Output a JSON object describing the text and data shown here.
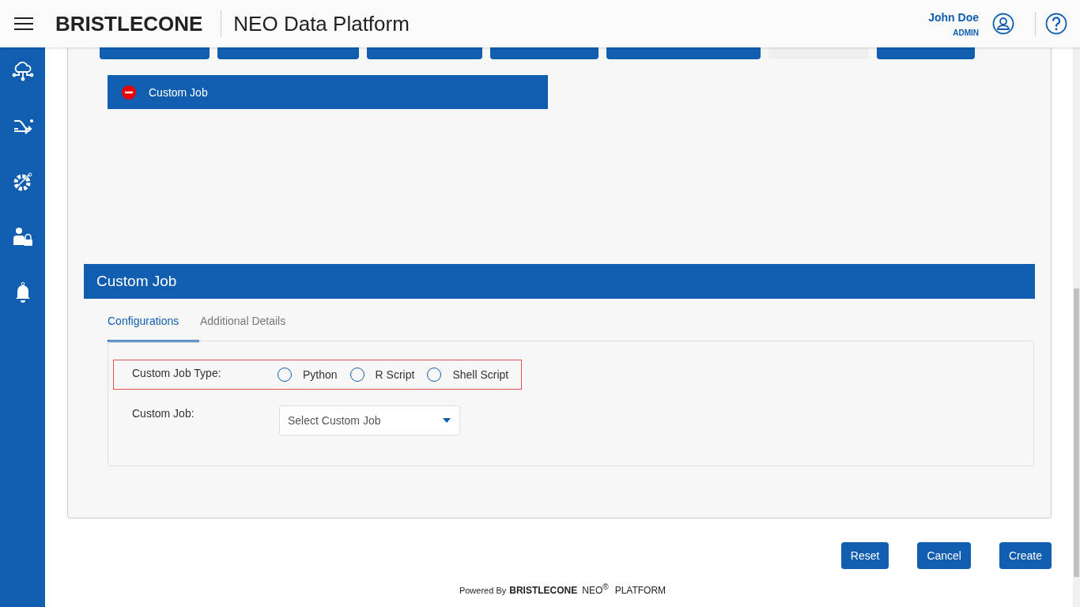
{
  "header": {
    "logo": "BRISTLECONE",
    "title": "NEO Data Platform",
    "user_name": "John Doe",
    "user_role": "ADMIN"
  },
  "sidebar": {
    "items": [
      {
        "kind": "cloud"
      },
      {
        "kind": "flow"
      },
      {
        "kind": "gear"
      },
      {
        "kind": "user-lock"
      },
      {
        "kind": "bell"
      }
    ]
  },
  "toolbar": {
    "buttons": [
      {
        "disabled": false
      },
      {
        "disabled": false
      },
      {
        "disabled": false
      },
      {
        "disabled": false
      },
      {
        "disabled": false
      },
      {
        "disabled": true
      },
      {
        "disabled": false
      }
    ]
  },
  "selected_job": {
    "label": "Custom Job"
  },
  "section": {
    "title": "Custom Job",
    "tabs": [
      {
        "label": "Configurations",
        "selected": true
      },
      {
        "label": "Additional Details",
        "selected": false
      }
    ],
    "job_type": {
      "label": "Custom Job Type:",
      "options": [
        {
          "label": "Python",
          "selected": false
        },
        {
          "label": "R Script",
          "selected": false
        },
        {
          "label": "Shell Script",
          "selected": false
        }
      ]
    },
    "job": {
      "label": "Custom Job:",
      "placeholder": "Select Custom Job"
    }
  },
  "actions": [
    "Reset",
    "Cancel",
    "Create"
  ],
  "footer": {
    "powered": "Powered By",
    "brand": "BRISTLECONE",
    "product": "NEO$^{®}$",
    "platform": "PLATFORM"
  }
}
